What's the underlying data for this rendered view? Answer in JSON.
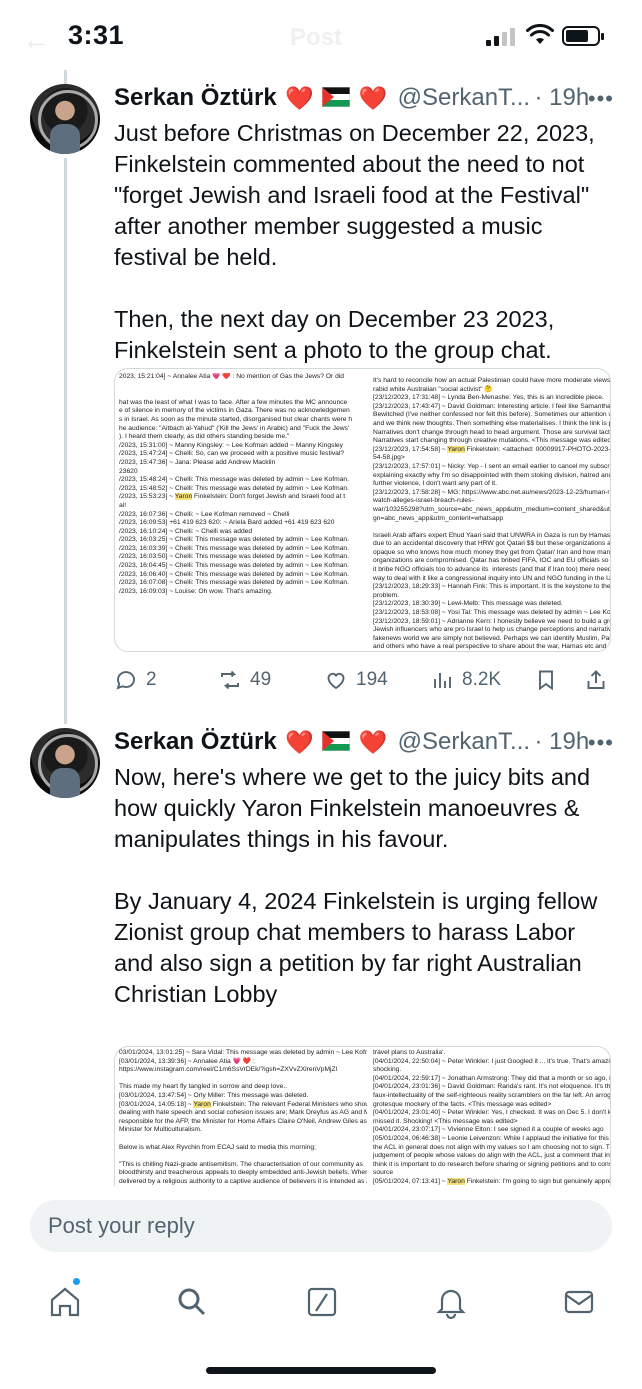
{
  "status_bar": {
    "time": "3:31",
    "ghost_back": "←",
    "ghost_title": "Post"
  },
  "tweets": [
    {
      "author": {
        "name": "Serkan Öztürk",
        "handle": "@SerkanT...",
        "time": "· 19h"
      },
      "text": "Just before Christmas on December 22, 2023, Finkelstein commented about the need to not \"forget Jewish and Israeli food at the Festival\" after another member suggested a music festival be held.\n\nThen, the next day on December 23 2023, Finkelstein sent a photo to the group chat.",
      "media": {
        "left_lines": [
          "2023, 15:21:04] ~ Annalee Atia 💗 ❤️ : No mention of Gas the Jews? Or did",
          "",
          "",
          "hat was the least of what I was to face. After a few minutes the MC announce",
          "e of silence in memory of the victims in Gaza. There was no acknowledgemen",
          "s in Israel. As soon as the minute started, disorganised but clear chants were h",
          "he audience: \"Aitbach al-Yahud\" ('Kill the Jews' in Arabic) and \"Fuck the Jews'",
          "). I heard them clearly, as did others standing beside me.\"",
          "/2023, 15:31:00] ~ Manny Kingsley: ~ Lee Kofman added ~ Manny Kingsley",
          "/2023, 15:47:24] ~ Chelli: So, can we proceed with a positive music festival?",
          "/2023, 15:47:36] ~ Jana: Please add Andrew Macklin",
          "23620",
          "/2023, 15:48:24] ~ Chelli: This message was deleted by admin ~ Lee Kofman.",
          "/2023, 15:48:52] ~ Chelli: This message was deleted by admin ~ Lee Kofman.",
          "/2023, 15:53:23] ~ Yaron Finkelstein: Don't forget Jewish and Israeli food at t",
          "al!",
          "/2023, 16:07:36] ~ Chelli: ~ Lee Kofman removed ~ Chelli",
          "/2023, 16:09:53] +61 419 623 620: ~ Ariela Bard added +61 419 623 620",
          "/2023, 16:10:24] ~ Chelli: ~ Chelli was added",
          "/2023, 16:03:25] ~ Chelli: This message was deleted by admin ~ Lee Kofman.",
          "/2023, 16:03:39] ~ Chelli: This message was deleted by admin ~ Lee Kofman.",
          "/2023, 16:03:50] ~ Chelli: This message was deleted by admin ~ Lee Kofman.",
          "/2023, 16:04:45] ~ Chelli: This message was deleted by admin ~ Lee Kofman.",
          "/2023, 16:06:40] ~ Chelli: This message was deleted by admin ~ Lee Kofman.",
          "/2023, 16:07:08] ~ Chelli: This message was deleted by admin ~ Lee Kofman.",
          "/2023, 16:09:03] ~ Louise: Oh wow. That's amazing."
        ],
        "right_lines": [
          "It's hard to reconcile how an actual Palestinian could have more moderate views than a",
          "rabid white Australian \"social activist\" 🤔",
          "[23/12/2023, 17:31:48] ~ Lynda Ben-Menashe: Yes, this is an incredible piece.",
          "[23/12/2023, 17:43:47] ~ David Goldman: Interesting article. I feel like Samantha in",
          "Bewitched (I've neither confessed nor felt this before). Sometimes our attention wonders",
          "and we think new thoughts. Then something else materialises. I think the link is poetics.",
          "Narratives don't change through head to head argument. Those are survival tactics.",
          "Narratives start changing through creative mutations. <This message was edited>",
          "[23/12/2023, 17:54:58] ~ Yaron Finkelstein: <attached: 00009917-PHOTO-2023-12-23-17-",
          "54-58.jpg>",
          "[23/12/2023, 17:57:01] ~ Nicky: Yep - I sent an email earlier to cancel my subscription",
          "explaining exactly why I'm so disappointed with them stoking division, hatred and inciting",
          "further violence, I don't want any part of it.",
          "[23/12/2023, 17:58:28] ~ MG: https://www.abc.net.au/news/2023-12-23/human-rights-",
          "watch-alleges-israel-breach-rules-",
          "war/103255298?utm_source=abc_news_app&utm_medium=content_shared&utm_campai",
          "gn=abc_news_app&utm_content=whatsapp",
          "",
          "Israeli Arab affairs expert Ehud Yaari said that UNWRA in Gaza is run by Hamas. We know",
          "due to an accidental discovery that HRW got Qatari $$ but these organizations are very",
          "opaque so who knows how much money they get from Qatar/ Iran and how many of these",
          "organizations are compromised. Qatar has bribed FIFA, IOC and EU officials so why wouldn't",
          "it bribe NGO officials too to advance its  interests (and that if Iran too) there needs to be a",
          "way to deal with it like a congressional inquiry into UN and NGO funding in the US.",
          "[23/12/2023, 18:29:33] ~ Hannah Fink: This is important. It is the keystone to the whole",
          "problem.",
          "[23/12/2023, 18:30:39] ~ Lewi-Melb: This message was deleted.",
          "[23/12/2023, 18:53:08] ~ Yosi Tal: This message was deleted by admin ~ Lee Kofman.",
          "[23/12/2023, 18:59:01] ~ Adrianne Kern: I honestly believe we need to build a group of non",
          "Jewish influencers who are pro Israel to help us change perceptions and narratives. In a",
          "fakenews world we are simply not believed. Perhaps we can identify Muslim, Palestinians",
          "and others who have a real perspective to share about the war, Hamas etc and we can help",
          "organise a programme of opeds, social media posts and videos? Some if this exists already",
          "but it's about getting more strategic with what we do with it.",
          "[23/12/2023, 19:12:03] ~ MG: And she is back!"
        ]
      },
      "stats": {
        "replies": "2",
        "reposts": "49",
        "likes": "194",
        "views": "8.2K"
      }
    },
    {
      "author": {
        "name": "Serkan Öztürk",
        "handle": "@SerkanT...",
        "time": "· 19h"
      },
      "text": "Now, here's where we get to the juicy bits and how quickly Yaron Finkelstein manoeuvres & manipulates things in his favour.\n\nBy January 4, 2024 Finkelstein is urging fellow Zionist group chat members to harass Labor and also sign a petition by far right Australian Christian Lobby",
      "media": {
        "left_lines": [
          "03/01/2024, 13:01:25] ~ Sara Vidal: This message was deleted by admin ~ Lee Kofman.",
          "[03/01/2024, 13:39:36] ~ Annalee Atia 💗 ❤️ :",
          "https://www.instagram.com/reel/C1m6SsVrDEk/?igsh=ZXVvZXlrenVpMjZl",
          "",
          "This made my heart fly tangled in sorrow and deep love..",
          "[03/01/2024, 13:47:54] ~ Orly Miller: This message was deleted.",
          "[03/01/2024, 14:05:18] ~ Yaron Finkelstein: The relevant Federal Ministers who should be",
          "dealing with hate speech and social cohesion issues are; Mark Dreyfus as AG and Minister",
          "responsible for the AFP, the Minister for Home Affairs Claire O'Neil, Andrew Giles as",
          "Minister for Multiculturalism.",
          "",
          "Below is what Alex Ryvchin from ECAJ said to media this morning;",
          "",
          "\"This is chilling Nazi-grade antisemitism. The characterisation of our community as",
          "bloodthirsty and treacherous appeals to deeply embedded anti-Jewish beliefs. When",
          "delivered by a religious authority to a captive audience of believers it is intended as a call to",
          "violence by Muslim Australians against Jewish Australians. It projects the killing of Jews as",
          "an act of self-defence and a sacred, religious duty. We cannot accept this in our country and"
        ],
        "right_lines": [
          "travel plans to Australia'.",
          "[04/01/2024, 22:50:04] ~ Peter Winkler: I just Googled it ... it's true. That's amazing and",
          "shocking.",
          "[04/01/2024, 22:59:17] ~ Jonathan Armstrong: They did that a month or so ago, if not more.",
          "[04/01/2024, 23:01:36] ~ David Goldman: Randa's rant. It's not eloquence. It's the textbook",
          "faux-intellectuality of the self-righteous reality scramblers on the far left. An arrogant,",
          "grotesque mockery of the facts. <This message was edited>",
          "[04/01/2024, 23:01:40] ~ Peter Winkler: Yes, I checked. It was on Dec 5. I don't know how I",
          "missed it. Shocking! <This message was edited>",
          "[04/01/2024, 23:07:17] ~ Vivienne Elton: I see signed it a couple of weeks ago",
          "[05/01/2024, 06:46:38] ~ Leonie Leivenzon: While I applaud the initiative for this petition,",
          "the ACL in general does not align with my values so I am choosing not to sign. This is not a",
          "judgement of people whose values do align with the ACL, just a comment that in general I",
          "think it is important to do research before sharing or signing petitions and to consider the",
          "source",
          "[05/01/2024, 07:13:41] ~ Yaron Finkelstein: I'm going to sign but genuinely appreciate",
          "others won't for various reasons."
        ]
      }
    }
  ],
  "reply_bar": {
    "placeholder": "Post your reply"
  },
  "colors": {
    "accent": "#1d9bf0",
    "text": "#0f1419",
    "muted": "#536471",
    "highlight": "#f6e27a"
  },
  "icons": [
    "reply-icon",
    "repost-icon",
    "like-icon",
    "views-icon",
    "bookmark-icon",
    "share-icon",
    "home-icon",
    "search-icon",
    "grok-icon",
    "notifications-icon",
    "messages-icon"
  ]
}
